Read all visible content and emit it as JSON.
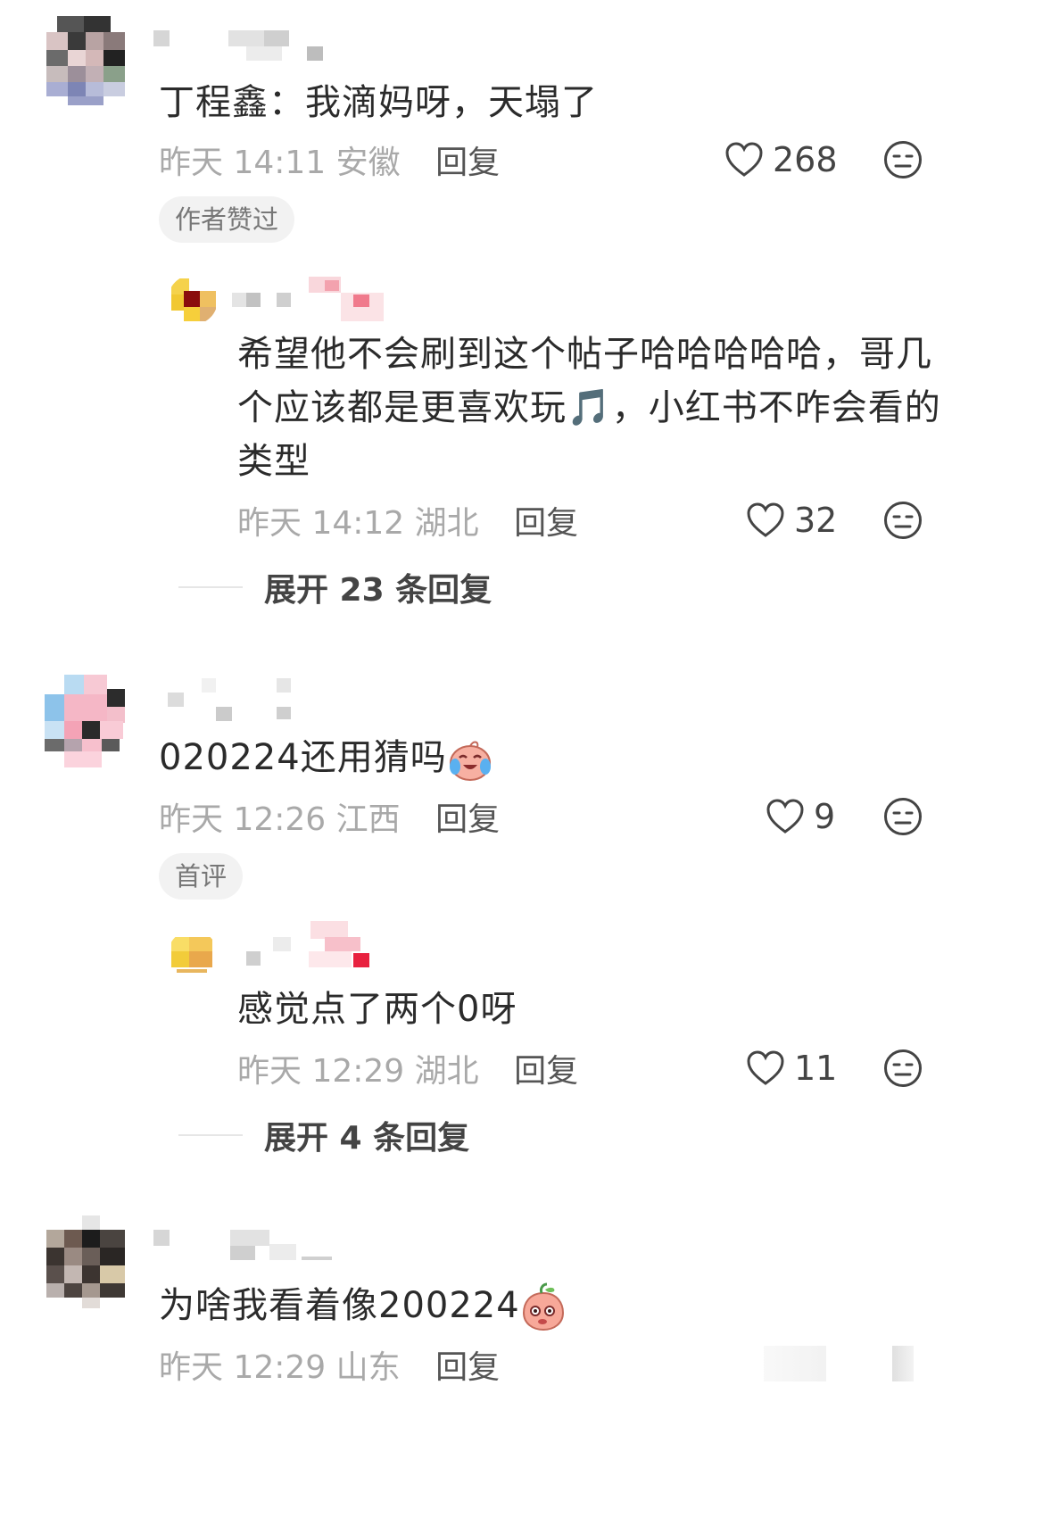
{
  "comments": [
    {
      "text": "丁程鑫：我滴妈呀，天塌了",
      "time": "昨天 14:11",
      "location": "安徽",
      "reply_label": "回复",
      "likes": "268",
      "tag": "作者赞过",
      "sub_reply": {
        "text_lines": [
          "希望他不会刷到这个帖子哈哈哈哈哈，哥几",
          "个应该都是更喜欢玩🎵，小红书不咋会看的",
          "类型"
        ],
        "time": "昨天 14:12",
        "location": "湖北",
        "reply_label": "回复",
        "likes": "32"
      },
      "expand_label": "展开 23 条回复"
    },
    {
      "text": "020224还用猜吗",
      "time": "昨天 12:26",
      "location": "江西",
      "reply_label": "回复",
      "likes": "9",
      "tag": "首评",
      "sub_reply": {
        "text": "感觉点了两个0呀",
        "time": "昨天 12:29",
        "location": "湖北",
        "reply_label": "回复",
        "likes": "11"
      },
      "expand_label": "展开 4 条回复"
    },
    {
      "text": "为啥我看着像200224",
      "time": "昨天 12:29",
      "location": "山东",
      "reply_label": "回复"
    }
  ],
  "icons": {
    "like": "heart-outline-icon",
    "dislike": "neutral-face-icon",
    "emoji_cry": "crying-laughing-emoji",
    "emoji_peach": "peach-emoji"
  },
  "colors": {
    "text": "#2b2b2b",
    "meta": "#a9a9a9",
    "tag_bg": "#f2f2f2"
  }
}
